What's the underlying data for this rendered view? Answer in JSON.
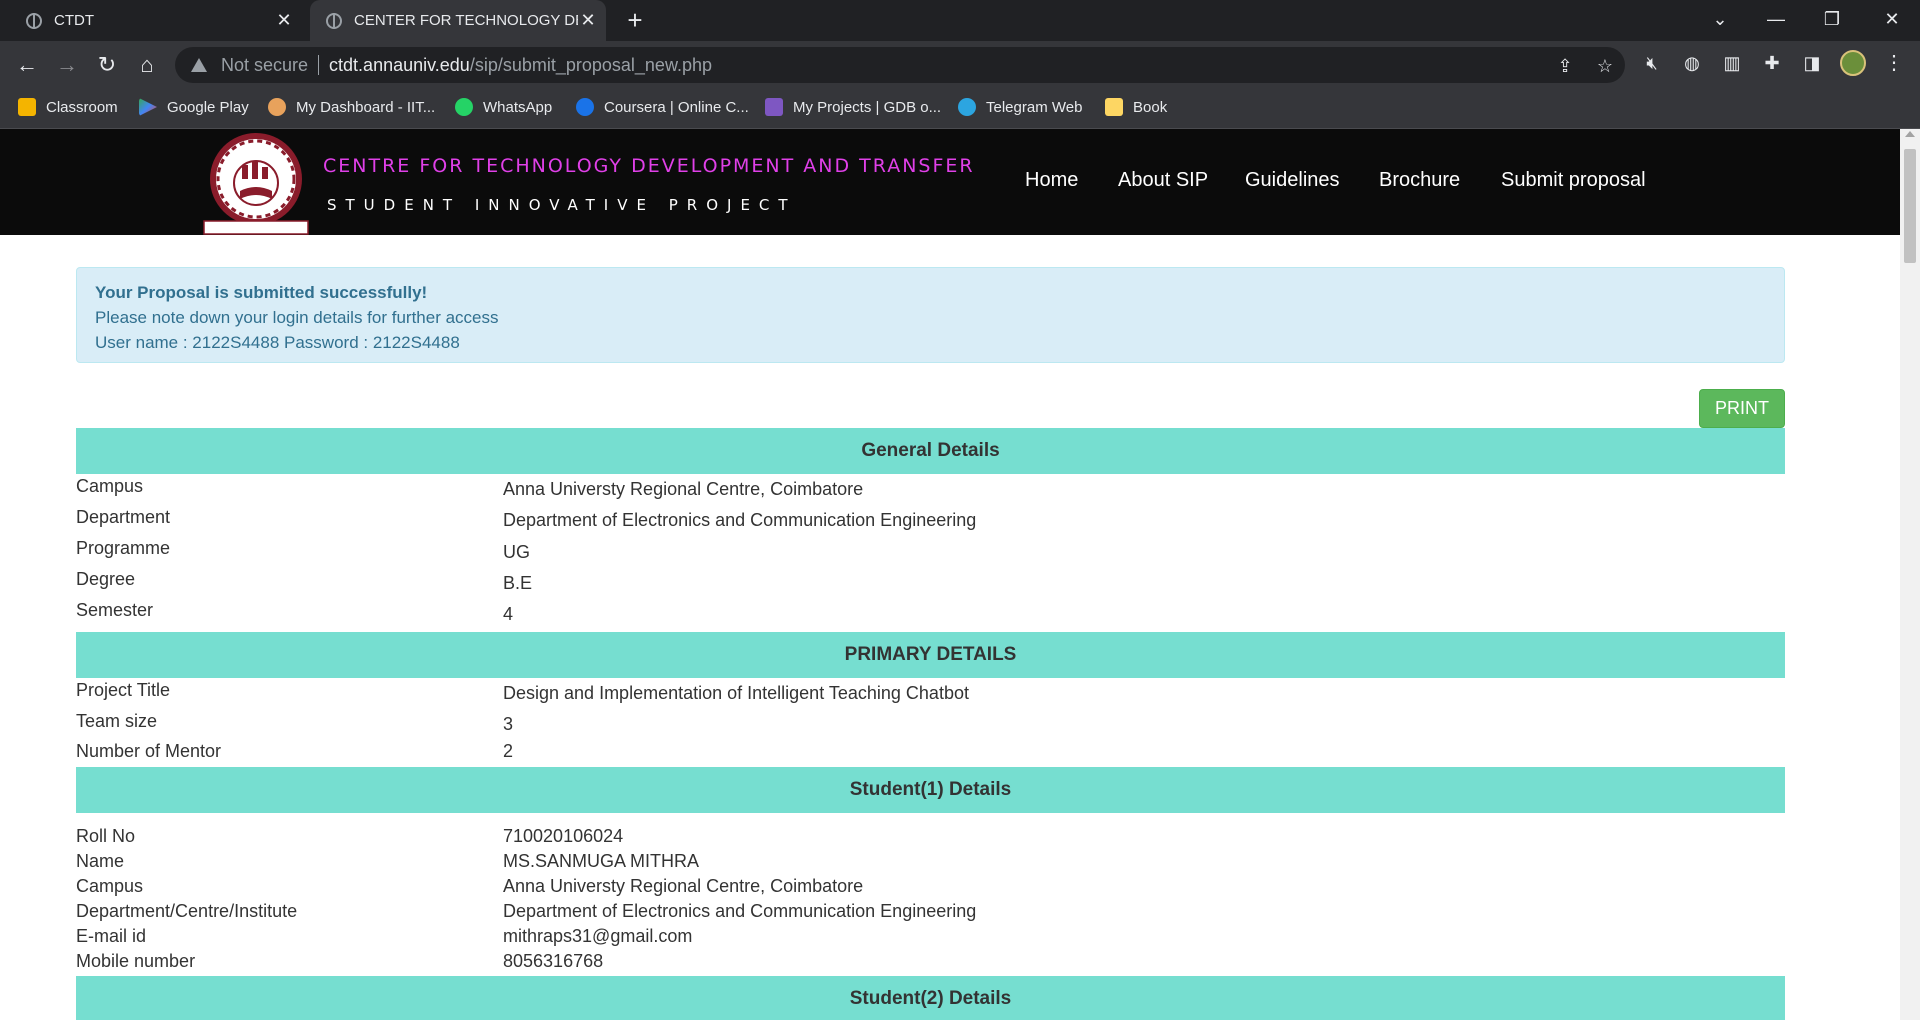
{
  "browser": {
    "tabs": [
      {
        "title": "CTDT"
      },
      {
        "title": "CENTER FOR TECHNOLOGY DEVE"
      }
    ],
    "new_tab": "+",
    "address": {
      "security": "Not secure",
      "host": "ctdt.annauniv.edu",
      "path": "/sip/submit_proposal_new.php"
    },
    "bookmarks": [
      {
        "label": "Classroom",
        "icon": "classroom-icon",
        "color": "#f4b400"
      },
      {
        "label": "Google Play",
        "icon": "google-play-icon",
        "color": "#34a853"
      },
      {
        "label": "My Dashboard - IIT...",
        "icon": "dashboard-icon",
        "color": "#e8a25c"
      },
      {
        "label": "WhatsApp",
        "icon": "whatsapp-icon",
        "color": "#25d366"
      },
      {
        "label": "Coursera | Online C...",
        "icon": "coursera-icon",
        "color": "#1a73e8"
      },
      {
        "label": "My Projects | GDB o...",
        "icon": "gdb-icon",
        "color": "#7e57c2"
      },
      {
        "label": "Telegram Web",
        "icon": "telegram-icon",
        "color": "#2ca5e0"
      },
      {
        "label": "Book",
        "icon": "folder-icon",
        "color": "#fdd663"
      }
    ]
  },
  "site": {
    "title": "CENTRE FOR TECHNOLOGY DEVELOPMENT AND TRANSFER",
    "subtitle": "STUDENT INNOVATIVE PROJECT",
    "logo_text": "ANNA UNIVERSITY",
    "logo_motto": "PROGRESS THROUGH KNOWLEDGE",
    "nav": [
      "Home",
      "About SIP",
      "Guidelines",
      "Brochure",
      "Submit proposal"
    ],
    "title_color": "#e040e8"
  },
  "alert": {
    "heading": "Your Proposal is submitted successfully!",
    "line1": "Please note down your login details for further access",
    "line2": "User name : 2122S4488 Password : 2122S4488"
  },
  "print_label": "PRINT",
  "sections": {
    "general": {
      "title": "General Details",
      "rows": [
        {
          "label": "Campus",
          "value": "Anna Universty Regional Centre, Coimbatore"
        },
        {
          "label": "Department",
          "value": "Department of Electronics and Communication Engineering"
        },
        {
          "label": "Programme",
          "value": "UG"
        },
        {
          "label": "Degree",
          "value": "B.E"
        },
        {
          "label": "Semester",
          "value": "4"
        }
      ]
    },
    "primary": {
      "title": "PRIMARY DETAILS",
      "rows": [
        {
          "label": "Project Title",
          "value": "Design and Implementation of Intelligent Teaching Chatbot"
        },
        {
          "label": "Team size",
          "value": "3"
        },
        {
          "label": "Number of Mentor",
          "value": "2"
        }
      ]
    },
    "student1": {
      "title": "Student(1) Details",
      "rows": [
        {
          "label": "Roll No",
          "value": "710020106024"
        },
        {
          "label": "Name",
          "value": "MS.SANMUGA MITHRA"
        },
        {
          "label": "Campus",
          "value": "Anna Universty Regional Centre, Coimbatore"
        },
        {
          "label": "Department/Centre/Institute",
          "value": "Department of Electronics and Communication Engineering"
        },
        {
          "label": "E-mail id",
          "value": "mithraps31@gmail.com"
        },
        {
          "label": "Mobile number",
          "value": "8056316768"
        }
      ]
    },
    "student2": {
      "title": "Student(2) Details"
    }
  },
  "colors": {
    "section_header": "#76ded0",
    "alert_bg": "#d9edf7",
    "alert_text": "#31708f",
    "print_button": "#5cb85c"
  }
}
